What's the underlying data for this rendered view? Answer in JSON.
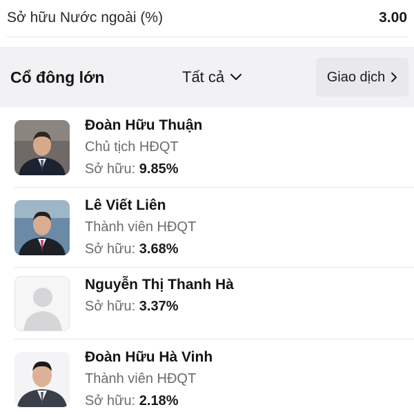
{
  "summary": {
    "label": "Sở hữu Nước ngoài (%)",
    "value": "3.00"
  },
  "section": {
    "title": "Cổ đông lớn",
    "filter_label": "Tất cả",
    "trade_label": "Giao dịch"
  },
  "shareholders": [
    {
      "name": "Đoàn Hữu Thuận",
      "role": "Chủ tịch HĐQT",
      "own_label": "Sở hữu:",
      "own_value": "9.85%",
      "avatar": "photo"
    },
    {
      "name": "Lê Viết Liên",
      "role": "Thành viên HĐQT",
      "own_label": "Sở hữu:",
      "own_value": "3.68%",
      "avatar": "photo"
    },
    {
      "name": "Nguyễn Thị Thanh Hà",
      "role": "",
      "own_label": "Sở hữu:",
      "own_value": "3.37%",
      "avatar": "placeholder-person-icon"
    },
    {
      "name": "Đoàn Hữu Hà Vinh",
      "role": "Thành viên HĐQT",
      "own_label": "Sở hữu:",
      "own_value": "2.18%",
      "avatar": "photo"
    }
  ]
}
